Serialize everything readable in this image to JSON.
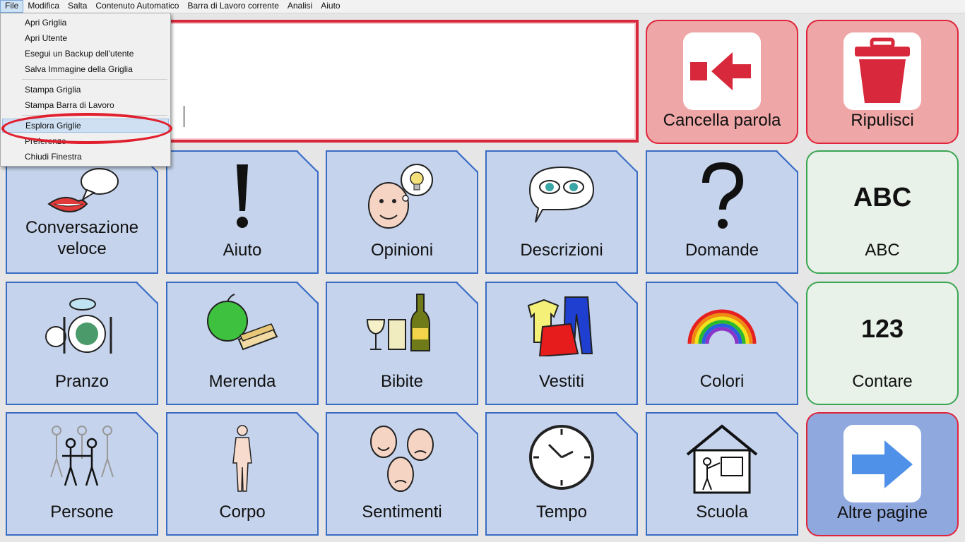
{
  "menubar": {
    "items": [
      "File",
      "Modifica",
      "Salta",
      "Contenuto Automatico",
      "Barra di Lavoro corrente",
      "Analisi",
      "Aiuto"
    ]
  },
  "file_menu": {
    "items": [
      {
        "label": "Apri Griglia"
      },
      {
        "label": "Apri Utente"
      },
      {
        "label": "Esegui un Backup dell'utente"
      },
      {
        "label": "Salva Immagine della Griglia"
      },
      {
        "label": "Stampa Griglia"
      },
      {
        "label": "Stampa Barra di Lavoro"
      },
      {
        "label": "Esplora Griglie"
      },
      {
        "label": "Preferenze"
      },
      {
        "label": "Chiudi Finestra"
      }
    ]
  },
  "top_buttons": {
    "delete_word": "Cancella parola",
    "clear": "Ripulisci"
  },
  "side_buttons": {
    "abc_symbol": "ABC",
    "abc_label": "ABC",
    "count_symbol": "123",
    "count_label": "Contare",
    "more_pages": "Altre pagine"
  },
  "cells": {
    "row1": [
      "Conversazione veloce",
      "Aiuto",
      "Opinioni",
      "Descrizioni",
      "Domande"
    ],
    "row2": [
      "Pranzo",
      "Merenda",
      "Bibite",
      "Vestiti",
      "Colori"
    ],
    "row3": [
      "Persone",
      "Corpo",
      "Sentimenti",
      "Tempo",
      "Scuola"
    ]
  },
  "colors": {
    "cell_blue": "#c5d3ec",
    "cell_border": "#3a6cc3",
    "red_accent": "#e0243b",
    "green_accent": "#3aa652"
  },
  "icons": {
    "delete_word": "arrow-left-stop-icon",
    "clear": "bin-icon",
    "more_pages": "arrow-right-icon"
  }
}
